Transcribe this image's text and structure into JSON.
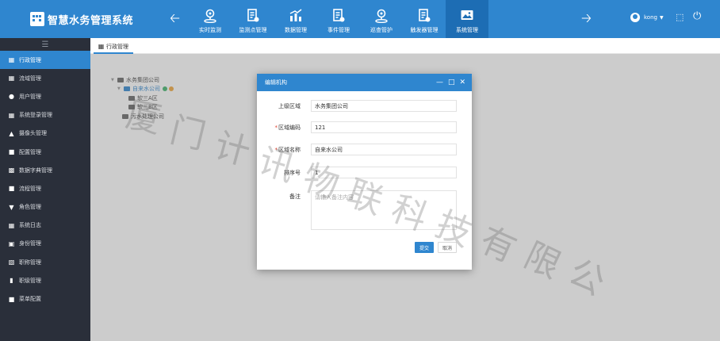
{
  "app": {
    "title": "智慧水务管理系统"
  },
  "nav": {
    "items": [
      {
        "label": "实时监测",
        "icon": "location-pin-icon"
      },
      {
        "label": "监测点管理",
        "icon": "document-gear-icon"
      },
      {
        "label": "数据管理",
        "icon": "bar-chart-icon"
      },
      {
        "label": "事件管理",
        "icon": "document-gear-icon"
      },
      {
        "label": "巡查管护",
        "icon": "location-pin-icon"
      },
      {
        "label": "触发器管理",
        "icon": "document-gear-icon"
      },
      {
        "label": "系统管理",
        "icon": "image-icon"
      }
    ],
    "active_index": 6
  },
  "user": {
    "name": "kong"
  },
  "sidebar": {
    "items": [
      {
        "label": "行政管理",
        "icon": "grid-icon",
        "active": true
      },
      {
        "label": "流域管理",
        "icon": "grid-icon"
      },
      {
        "label": "用户管理",
        "icon": "user-icon"
      },
      {
        "label": "系统登录管理",
        "icon": "grid-icon"
      },
      {
        "label": "摄像头管理",
        "icon": "sitemap-icon"
      },
      {
        "label": "配置管理",
        "icon": "clipboard-icon"
      },
      {
        "label": "数据字典管理",
        "icon": "book-icon"
      },
      {
        "label": "流程管理",
        "icon": "clipboard-icon"
      },
      {
        "label": "角色管理",
        "icon": "shield-icon"
      },
      {
        "label": "系统日志",
        "icon": "grid-icon"
      },
      {
        "label": "身份管理",
        "icon": "id-card-icon"
      },
      {
        "label": "职称管理",
        "icon": "badge-icon"
      },
      {
        "label": "职级管理",
        "icon": "bar-chart-icon"
      },
      {
        "label": "菜单配置",
        "icon": "clipboard-icon"
      }
    ]
  },
  "tab": {
    "label": "行政管理"
  },
  "tree": {
    "root": "水务集团公司",
    "selected": "自来水公司",
    "children": [
      "软三A区",
      "软三B区"
    ],
    "sibling": "污水处理公司"
  },
  "modal": {
    "title": "编辑机构",
    "fields": {
      "parent_area": {
        "label": "上级区域",
        "value": "水务集团公司"
      },
      "area_code": {
        "label": "区域编码",
        "value": "121"
      },
      "area_name": {
        "label": "区域名称",
        "value": "自来水公司"
      },
      "sort_no": {
        "label": "排序号",
        "value": "1"
      },
      "remark": {
        "label": "备注",
        "placeholder": "请输入备注内容"
      }
    },
    "submit_label": "提交",
    "cancel_label": "取消"
  },
  "watermark": {
    "text": "厦门计讯物联科技有限公"
  },
  "colors": {
    "primary": "#2f86cf",
    "sidebar_bg": "#2a2f3a",
    "required": "#e0412f"
  }
}
